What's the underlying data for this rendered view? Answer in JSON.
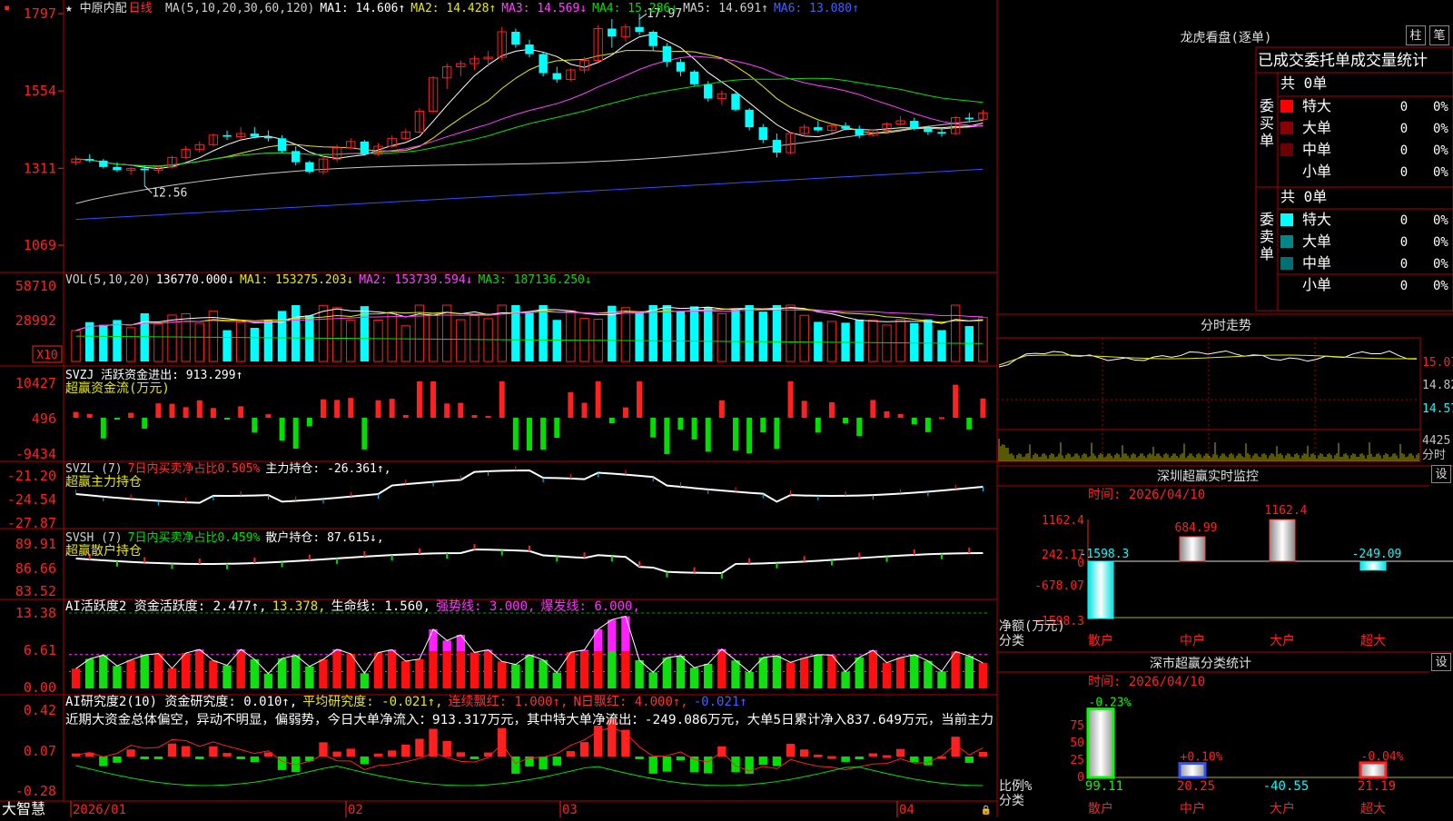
{
  "stock": {
    "name": "中原内配",
    "period": "日线",
    "star": "★"
  },
  "ma_line": [
    {
      "text": "MA(5,10,20,30,60,120)",
      "color": "#d0d0d0"
    },
    {
      "text": "MA1: 14.606↑",
      "color": "#ffffff"
    },
    {
      "text": "MA2: 14.428↑",
      "color": "#e8e800"
    },
    {
      "text": "MA3: 14.569↓",
      "color": "#ff40ff"
    },
    {
      "text": "MA4: 15.286↓",
      "color": "#00e000"
    },
    {
      "text": "MA5: 14.691↑",
      "color": "#d0d0d0"
    },
    {
      "text": "MA6: 13.080↑",
      "color": "#4060ff"
    }
  ],
  "vol_line": [
    {
      "text": "VOL(5,10,20)",
      "color": "#d0d0d0"
    },
    {
      "text": "136770.000↓",
      "color": "#ffffff"
    },
    {
      "text": "MA1: 153275.203↓",
      "color": "#e8e800"
    },
    {
      "text": "MA2: 153739.594↓",
      "color": "#ff40ff"
    },
    {
      "text": "MA3: 187136.250↓",
      "color": "#00e000"
    }
  ],
  "svzj_line": [
    {
      "text": "SVZJ  活跃资金进出: 913.299↑",
      "color": "#ffffff"
    }
  ],
  "svzj_sub": "超赢资金流(万元)",
  "svzl_line": [
    {
      "text": "SVZL (7)",
      "color": "#d0d0d0"
    },
    {
      "text": "7日内买卖净占比0.505%",
      "color": "#ff3030"
    },
    {
      "text": "主力持仓: -26.361↑,",
      "color": "#ffffff"
    }
  ],
  "svzl_sub": "超赢主力持仓",
  "svsh_line": [
    {
      "text": "SVSH (7)",
      "color": "#d0d0d0"
    },
    {
      "text": "7日内买卖净占比0.459%",
      "color": "#00e000"
    },
    {
      "text": "散户持仓: 87.615↓,",
      "color": "#ffffff"
    }
  ],
  "svsh_sub": "超赢散户持仓",
  "ai_line": [
    {
      "text": "AI活跃度2 资金活跃度: 2.477↑,",
      "color": "#ffffff"
    },
    {
      "text": "13.378,",
      "color": "#e8e800"
    },
    {
      "text": "生命线: 1.560,",
      "color": "#ffffff"
    },
    {
      "text": "强势线: 3.000,",
      "color": "#ff30ff"
    },
    {
      "text": "爆发线: 6.000,",
      "color": "#ff30ff"
    }
  ],
  "ai2_line": [
    {
      "text": "AI研究度2(10) 资金研究度: 0.010↑,",
      "color": "#ffffff"
    },
    {
      "text": "平均研究度: -0.021↑,",
      "color": "#e8e800"
    },
    {
      "text": "连续飘红: 1.000↑,",
      "color": "#ff3030"
    },
    {
      "text": "N日飘红: 4.000↑,",
      "color": "#ff3030"
    },
    {
      "text": "-0.021↑",
      "color": "#4060ff"
    }
  ],
  "ai2_comment": "近期大资金总体偏空，异动不明显，偏弱势，今日大单净流入：913.317万元，其中特大单净流出：-249.086万元，大单5日累计净入837.649万元，当前主力",
  "axis_labels": {
    "price": [
      "1797",
      "1554",
      "1311",
      "1069"
    ],
    "vol": [
      "58710",
      "28992"
    ],
    "vol_unit": "X10",
    "svzj": [
      "10427",
      "496",
      "-9434"
    ],
    "svzl": [
      "-21.20",
      "-24.54",
      "-27.87"
    ],
    "svsh": [
      "89.91",
      "86.66",
      "83.52"
    ],
    "ai": [
      "13.38",
      "6.61",
      "0.00"
    ],
    "ai2": [
      "0.42",
      "0.07",
      "-0.28"
    ]
  },
  "price_marks": {
    "high": "17.97",
    "low": "12.56"
  },
  "date_labels": [
    "2026/01",
    "02",
    "03",
    "04"
  ],
  "brand": "大智慧",
  "dragon": {
    "title": "龙虎看盘(逐单)",
    "btn_bar": "柱",
    "btn_pen": "笔",
    "header": "已成交委托单成交量统计",
    "buy_label": "委买单",
    "sell_label": "委卖单",
    "buy_total": "共 0单",
    "sell_total": "共 0单",
    "buy_rows": [
      {
        "name": "特大",
        "count": "0",
        "pct": "0%",
        "color": "#ff0000"
      },
      {
        "name": "大单",
        "count": "0",
        "pct": "0%",
        "color": "#8a0000"
      },
      {
        "name": "中单",
        "count": "0",
        "pct": "0%",
        "color": "#6a0000"
      },
      {
        "name": "小单",
        "count": "0",
        "pct": "0%",
        "color": ""
      }
    ],
    "sell_rows": [
      {
        "name": "特大",
        "count": "0",
        "pct": "0%",
        "color": "#00ffff"
      },
      {
        "name": "大单",
        "count": "0",
        "pct": "0%",
        "color": "#008888"
      },
      {
        "name": "中单",
        "count": "0",
        "pct": "0%",
        "color": "#007070"
      },
      {
        "name": "小单",
        "count": "0",
        "pct": "0%",
        "color": ""
      }
    ]
  },
  "intraday": {
    "title": "分时走势",
    "labels": [
      "15.07",
      "14.82",
      "14.57",
      "4425",
      "分时"
    ]
  },
  "monitor": {
    "title": "深圳超赢实时监控",
    "set": "设",
    "time": "时间: 2026/04/10",
    "y_labels": [
      "1162.4",
      "242.17",
      "0",
      "-678.07",
      "-1598.3"
    ],
    "side_label": "净额(万元)",
    "side_label2": "分类",
    "categories": [
      "散户",
      "中户",
      "大户",
      "超大"
    ],
    "values": [
      -1598.3,
      684.99,
      1162.4,
      -249.09
    ],
    "value_labels": [
      "-1598.3",
      "684.99",
      "1162.4",
      "-249.09"
    ]
  },
  "classify": {
    "title": "深市超赢分类统计",
    "set": "设",
    "time": "时间: 2026/04/10",
    "y_labels": [
      "75",
      "50",
      "25",
      "0"
    ],
    "side_label": "比例%",
    "side_label2": "分类",
    "categories": [
      "散户",
      "中户",
      "大户",
      "超大"
    ],
    "values": [
      99.11,
      20.25,
      -40.55,
      21.19
    ],
    "value_labels": [
      "99.11",
      "20.25",
      "-40.55",
      "21.19"
    ],
    "change_labels": [
      "-0.23%",
      "+0.10%",
      "",
      "-0.04%"
    ]
  },
  "chart_data": {
    "type": "candlestick",
    "title": "中原内配 日线",
    "x_labels": [
      "2026/01",
      "02",
      "03",
      "04"
    ],
    "ylim": [
      10.69,
      17.97
    ],
    "candles": [
      [
        13.3,
        13.5,
        13.2,
        13.4
      ],
      [
        13.4,
        13.55,
        13.3,
        13.35
      ],
      [
        13.35,
        13.4,
        13.1,
        13.15
      ],
      [
        13.15,
        13.3,
        13.0,
        13.05
      ],
      [
        13.05,
        13.15,
        12.9,
        13.1
      ],
      [
        13.1,
        13.2,
        12.56,
        13.05
      ],
      [
        13.05,
        13.2,
        12.95,
        13.15
      ],
      [
        13.15,
        13.5,
        13.1,
        13.45
      ],
      [
        13.45,
        13.8,
        13.4,
        13.7
      ],
      [
        13.7,
        13.95,
        13.6,
        13.85
      ],
      [
        13.85,
        14.2,
        13.8,
        14.15
      ],
      [
        14.15,
        14.3,
        14.0,
        14.1
      ],
      [
        14.1,
        14.4,
        14.0,
        14.2
      ],
      [
        14.2,
        14.4,
        14.05,
        14.1
      ],
      [
        14.1,
        14.3,
        13.95,
        14.05
      ],
      [
        14.05,
        14.15,
        13.6,
        13.65
      ],
      [
        13.65,
        13.8,
        13.2,
        13.3
      ],
      [
        13.3,
        13.35,
        12.95,
        13.0
      ],
      [
        13.0,
        13.5,
        12.9,
        13.4
      ],
      [
        13.4,
        13.85,
        13.3,
        13.75
      ],
      [
        13.75,
        14.05,
        13.7,
        13.95
      ],
      [
        13.95,
        14.0,
        13.5,
        13.55
      ],
      [
        13.55,
        13.9,
        13.5,
        13.8
      ],
      [
        13.8,
        14.15,
        13.75,
        14.05
      ],
      [
        14.05,
        14.35,
        14.0,
        14.25
      ],
      [
        14.25,
        15.0,
        14.2,
        14.9
      ],
      [
        14.9,
        16.0,
        14.85,
        15.95
      ],
      [
        15.95,
        16.4,
        15.6,
        16.3
      ],
      [
        16.3,
        16.5,
        16.0,
        16.4
      ],
      [
        16.4,
        16.65,
        16.2,
        16.55
      ],
      [
        16.55,
        16.8,
        16.3,
        16.6
      ],
      [
        16.6,
        17.55,
        16.5,
        17.4
      ],
      [
        17.4,
        17.5,
        16.9,
        17.0
      ],
      [
        17.0,
        17.15,
        16.6,
        16.7
      ],
      [
        16.7,
        16.75,
        16.0,
        16.1
      ],
      [
        16.1,
        16.3,
        15.8,
        15.9
      ],
      [
        15.9,
        16.25,
        15.85,
        16.2
      ],
      [
        16.2,
        16.6,
        16.1,
        16.5
      ],
      [
        16.5,
        17.6,
        16.45,
        17.5
      ],
      [
        17.5,
        17.8,
        16.9,
        17.25
      ],
      [
        17.25,
        17.65,
        17.1,
        17.55
      ],
      [
        17.55,
        17.97,
        17.3,
        17.4
      ],
      [
        17.4,
        17.45,
        16.8,
        16.95
      ],
      [
        16.95,
        17.05,
        16.3,
        16.45
      ],
      [
        16.45,
        16.55,
        16.0,
        16.15
      ],
      [
        16.15,
        16.2,
        15.7,
        15.75
      ],
      [
        15.75,
        15.85,
        15.2,
        15.3
      ],
      [
        15.3,
        15.55,
        15.1,
        15.45
      ],
      [
        15.45,
        15.5,
        14.9,
        14.95
      ],
      [
        14.95,
        15.0,
        14.3,
        14.4
      ],
      [
        14.4,
        14.5,
        13.9,
        14.0
      ],
      [
        14.0,
        14.2,
        13.45,
        13.6
      ],
      [
        13.6,
        14.25,
        13.55,
        14.2
      ],
      [
        14.2,
        14.5,
        14.1,
        14.4
      ],
      [
        14.4,
        14.6,
        14.25,
        14.3
      ],
      [
        14.3,
        14.5,
        14.2,
        14.45
      ],
      [
        14.45,
        14.55,
        14.3,
        14.35
      ],
      [
        14.35,
        14.45,
        14.05,
        14.15
      ],
      [
        14.15,
        14.35,
        14.1,
        14.3
      ],
      [
        14.3,
        14.55,
        14.25,
        14.5
      ],
      [
        14.5,
        14.75,
        14.45,
        14.6
      ],
      [
        14.6,
        14.7,
        14.3,
        14.35
      ],
      [
        14.35,
        14.45,
        14.15,
        14.25
      ],
      [
        14.25,
        14.35,
        14.1,
        14.2
      ],
      [
        14.2,
        14.75,
        14.15,
        14.7
      ],
      [
        14.7,
        14.85,
        14.55,
        14.65
      ],
      [
        14.65,
        14.95,
        14.6,
        14.85
      ]
    ]
  }
}
